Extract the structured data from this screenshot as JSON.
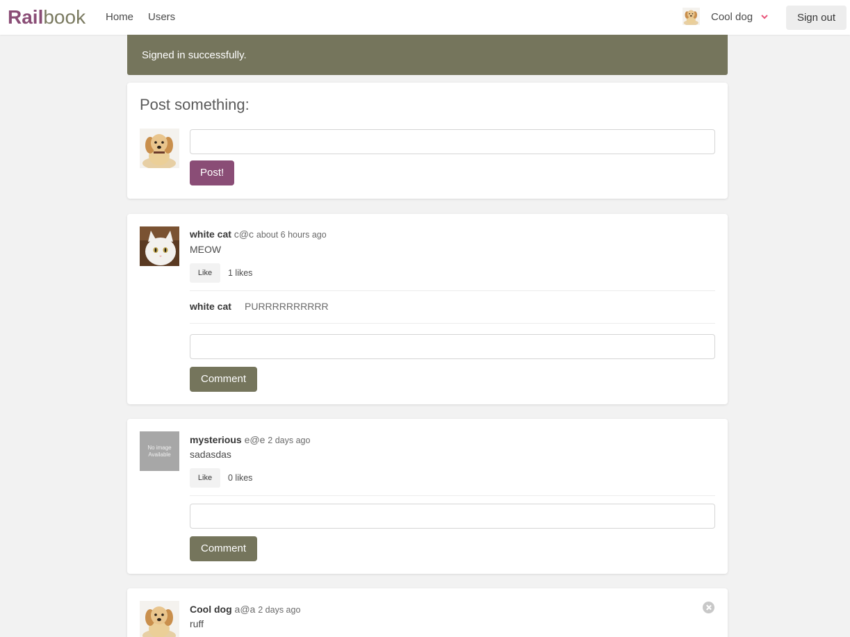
{
  "nav": {
    "brand_bold": "Rail",
    "brand_light": "book",
    "home": "Home",
    "users": "Users",
    "current_user": "Cool dog",
    "sign_out": "Sign out"
  },
  "flash": "Signed in successfully.",
  "composer": {
    "heading": "Post something:",
    "button": "Post!"
  },
  "posts": [
    {
      "author": "white cat",
      "email": "c@c",
      "time": "about 6 hours ago",
      "body": "MEOW",
      "like_label": "Like",
      "likes": "1 likes",
      "avatar": "white-cat-photo",
      "comments": [
        {
          "author": "white cat",
          "text": "PURRRRRRRRRR"
        }
      ],
      "comment_button": "Comment"
    },
    {
      "author": "mysterious",
      "email": "e@e",
      "time": "2 days ago",
      "body": "sadasdas",
      "like_label": "Like",
      "likes": "0 likes",
      "avatar_text": "No image Available",
      "comments": [],
      "comment_button": "Comment"
    },
    {
      "author": "Cool dog",
      "email": "a@a",
      "time": "2 days ago",
      "body": "ruff",
      "avatar": "puppy-photo"
    }
  ],
  "colors": {
    "brand": "#8a4d76",
    "olive": "#75755c",
    "background": "#f2f2f2",
    "chevron": "#e8547a"
  }
}
